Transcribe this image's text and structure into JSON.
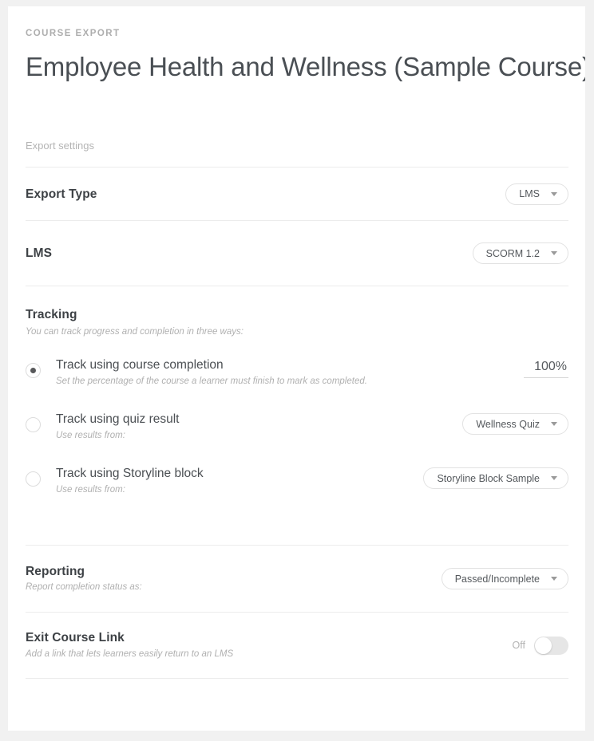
{
  "header": {
    "eyebrow": "COURSE EXPORT",
    "title": "Employee Health and Wellness (Sample Course)"
  },
  "settings": {
    "section_label": "Export settings"
  },
  "export_type": {
    "title": "Export Type",
    "value": "LMS",
    "caret_icon": "chevron-down-icon"
  },
  "lms": {
    "title": "LMS",
    "value": "SCORM 1.2",
    "caret_icon": "chevron-down-icon"
  },
  "tracking": {
    "title": "Tracking",
    "subtitle": "You can track progress and completion in three ways:",
    "options": [
      {
        "title": "Track using course completion",
        "subtitle": "Set the percentage of the course a learner must finish to mark as completed.",
        "selected": true,
        "control": "percent",
        "value": "100%"
      },
      {
        "title": "Track using quiz result",
        "subtitle": "Use results from:",
        "selected": false,
        "control": "dropdown",
        "value": "Wellness Quiz"
      },
      {
        "title": "Track using Storyline block",
        "subtitle": "Use results from:",
        "selected": false,
        "control": "dropdown",
        "value": "Storyline Block Sample"
      }
    ]
  },
  "reporting": {
    "title": "Reporting",
    "subtitle": "Report completion status as:",
    "value": "Passed/Incomplete",
    "caret_icon": "chevron-down-icon"
  },
  "exit_course_link": {
    "title": "Exit Course Link",
    "subtitle": "Add a link that lets learners easily return to an LMS",
    "toggle_label": "Off",
    "toggle_on": false
  },
  "colors": {
    "page_background": "#f1f1f1",
    "card_background": "#ffffff",
    "title_text": "#4a4f54",
    "muted_text": "#b0b0b0",
    "divider": "#ececec"
  }
}
